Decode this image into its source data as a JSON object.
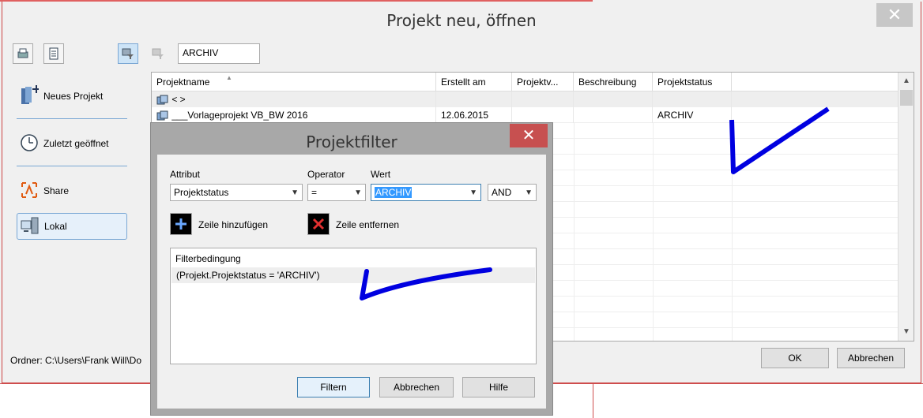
{
  "window": {
    "title": "Projekt neu, öffnen",
    "close_glyph": "✕"
  },
  "toolbar": {
    "filter_value": "ARCHIV"
  },
  "sidebar": {
    "items": [
      {
        "label": "Neues Projekt",
        "icon": "new-project-icon"
      },
      {
        "label": "Zuletzt geöffnet",
        "icon": "clock-icon"
      },
      {
        "label": "Share",
        "icon": "share-icon"
      },
      {
        "label": "Lokal",
        "icon": "computer-icon"
      }
    ]
  },
  "table": {
    "columns": [
      "Projektname",
      "Erstellt am",
      "Projektv...",
      "Beschreibung",
      "Projektstatus"
    ],
    "rows": [
      {
        "name": "<      >",
        "created": "",
        "version": "",
        "description": "",
        "status": ""
      },
      {
        "name": "___Vorlageprojekt VB_BW 2016",
        "created": "12.06.2015",
        "version": "",
        "description": "",
        "status": "ARCHIV"
      }
    ],
    "sort_glyph": "▲"
  },
  "footer": {
    "path": "Ordner: C:\\Users\\Frank Will\\Do",
    "ok_label": "OK",
    "cancel_label": "Abbrechen"
  },
  "dialog": {
    "title": "Projektfilter",
    "close_glyph": "✕",
    "attribute_label": "Attribut",
    "operator_label": "Operator",
    "value_label": "Wert",
    "attribute_value": "Projektstatus",
    "operator_value": "=",
    "value_value": "ARCHIV",
    "logic_value": "AND",
    "add_row_label": "Zeile hinzufügen",
    "remove_row_label": "Zeile entfernen",
    "filter_header": "Filterbedingung",
    "filter_condition": "(Projekt.Projektstatus = 'ARCHIV')",
    "filter_button": "Filtern",
    "cancel_button": "Abbrechen",
    "help_button": "Hilfe"
  },
  "colors": {
    "dialog_close": "#c75050",
    "annotation": "#0000e0",
    "selection": "#3399ff"
  }
}
